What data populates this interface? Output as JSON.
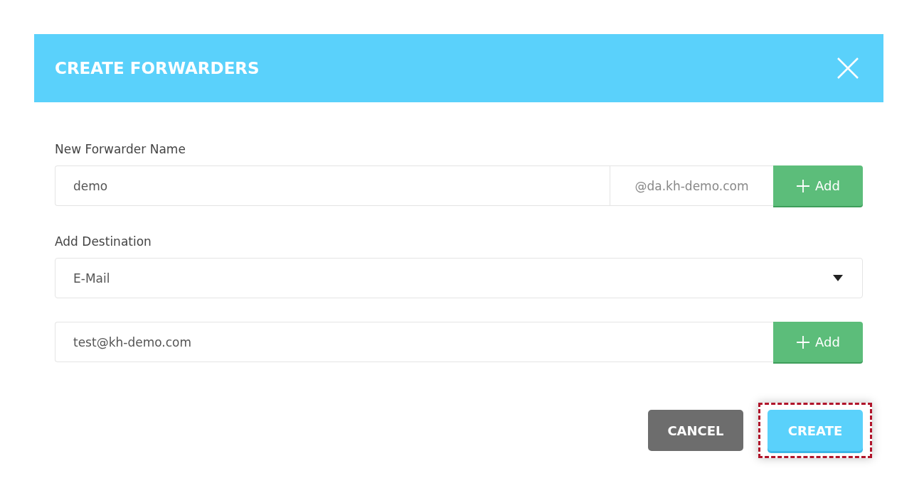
{
  "dialog": {
    "title": "CREATE FORWARDERS"
  },
  "name_field": {
    "label": "New Forwarder Name",
    "value": "demo",
    "domain": "@da.kh-demo.com",
    "add_button": "Add"
  },
  "destination": {
    "label": "Add Destination",
    "type_select": "E-Mail",
    "value": "test@kh-demo.com",
    "add_button": "Add"
  },
  "buttons": [
    {
      "label": "CANCEL",
      "kind": "cancel",
      "highlighted": false
    },
    {
      "label": "CREATE",
      "kind": "primary",
      "highlighted": true
    }
  ]
}
